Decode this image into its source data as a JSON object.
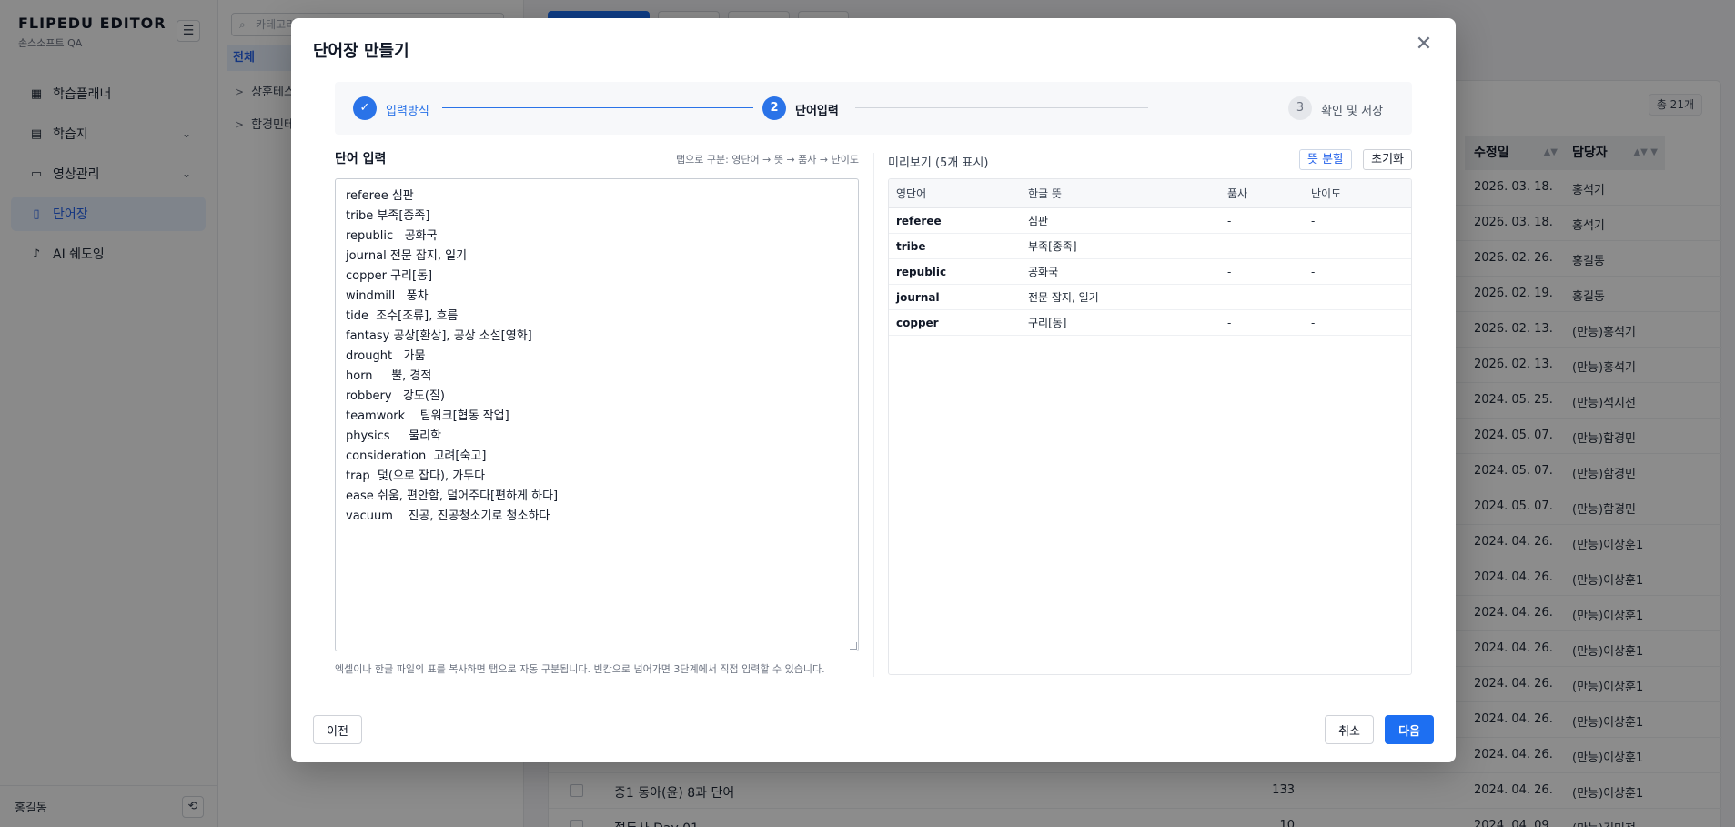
{
  "sidebar": {
    "brand_title": "FLIPEDU EDITOR",
    "brand_sub": "손스소프트 QA",
    "items": [
      {
        "label": "학습플래너",
        "icon": "calendar-icon",
        "has_chevron": false,
        "active": false
      },
      {
        "label": "학습지",
        "icon": "document-icon",
        "has_chevron": true,
        "active": false
      },
      {
        "label": "영상관리",
        "icon": "video-icon",
        "has_chevron": true,
        "active": false
      },
      {
        "label": "단어장",
        "icon": "book-icon",
        "has_chevron": false,
        "active": true
      },
      {
        "label": "AI 쉐도잉",
        "icon": "microphone-icon",
        "has_chevron": false,
        "active": false
      }
    ],
    "user": "홍길동"
  },
  "categories": {
    "search_placeholder": "카테고리",
    "all": "전체",
    "rows": [
      "상훈테스",
      "함경민테"
    ]
  },
  "list": {
    "total": "총 21개",
    "headers": {
      "modified": "수정일",
      "owner": "담당자"
    },
    "rows": [
      {
        "name": "",
        "count": "",
        "date": "2026. 03. 18.",
        "owner": "홍석기"
      },
      {
        "name": "",
        "count": "",
        "date": "2026. 03. 18.",
        "owner": "홍석기"
      },
      {
        "name": "",
        "count": "",
        "date": "2026. 02. 26.",
        "owner": "홍길동"
      },
      {
        "name": "",
        "count": "",
        "date": "2026. 02. 19.",
        "owner": "홍길동"
      },
      {
        "name": "",
        "count": "",
        "date": "2026. 02. 13.",
        "owner": "(만능)홍석기"
      },
      {
        "name": "",
        "count": "",
        "date": "2026. 02. 13.",
        "owner": "(만능)홍석기"
      },
      {
        "name": "",
        "count": "",
        "date": "2024. 05. 25.",
        "owner": "(만능)석지선"
      },
      {
        "name": "",
        "count": "",
        "date": "2024. 05. 07.",
        "owner": "(만능)함경민"
      },
      {
        "name": "",
        "count": "",
        "date": "2024. 05. 07.",
        "owner": "(만능)함경민"
      },
      {
        "name": "",
        "count": "",
        "date": "2024. 05. 07.",
        "owner": "(만능)함경민"
      },
      {
        "name": "",
        "count": "",
        "date": "2024. 04. 26.",
        "owner": "(만능)이상훈1"
      },
      {
        "name": "",
        "count": "",
        "date": "2024. 04. 26.",
        "owner": "(만능)이상훈1"
      },
      {
        "name": "",
        "count": "",
        "date": "2024. 04. 26.",
        "owner": "(만능)이상훈1"
      },
      {
        "name": "",
        "count": "",
        "date": "2024. 04. 26.",
        "owner": "(만능)이상훈1"
      },
      {
        "name": "",
        "count": "",
        "date": "2024. 04. 26.",
        "owner": "(만능)이상훈1"
      },
      {
        "name": "",
        "count": "",
        "date": "2024. 04. 26.",
        "owner": "(만능)이상훈1"
      },
      {
        "name": "",
        "count": "",
        "date": "2024. 04. 26.",
        "owner": "(만능)이상훈1"
      },
      {
        "name": "중1 동아(윤) 8과 단어",
        "count": "133",
        "date": "2024. 04. 26.",
        "owner": "(만능)이상훈1"
      },
      {
        "name": "접두사 Day 01",
        "count": "10",
        "date": "2024. 04. 09.",
        "owner": "(만능)김민정"
      }
    ]
  },
  "modal": {
    "title": "단어장 만들기",
    "steps": [
      {
        "number": "",
        "label": "입력방식",
        "state": "done"
      },
      {
        "number": "2",
        "label": "단어입력",
        "state": "current"
      },
      {
        "number": "3",
        "label": "확인 및 저장",
        "state": "pending"
      }
    ],
    "input": {
      "title": "단어 입력",
      "hint": "탭으로 구분: 영단어 → 뜻 → 품사 → 난이도",
      "text": "referee 심판\ntribe 부족[종족]\nrepublic   공화국\njournal 전문 잡지, 일기\ncopper 구리[동]\nwindmill   풍차\ntide  조수[조류], 흐름\nfantasy 공상[환상], 공상 소설[영화]\ndrought   가뭄\nhorn     뿔, 경적\nrobbery   강도(질)\nteamwork    팀워크[협동 작업]\nphysics     물리학\nconsideration  고려[숙고]\ntrap  덫(으로 잡다), 가두다\nease 쉬움, 편안함, 덜어주다[편하게 하다]\nvacuum    진공, 진공청소기로 청소하다",
      "footnote": "엑셀이나 한글 파일의 표를 복사하면 탭으로 자동 구분됩니다. 빈칸으로 넘어가면 3단계에서 직접 입력할 수 있습니다."
    },
    "preview": {
      "title": "미리보기 (5개 표시)",
      "split_label": "뜻 분할",
      "reset_label": "초기화",
      "headers": [
        "영단어",
        "한글 뜻",
        "품사",
        "난이도"
      ],
      "rows": [
        [
          "referee",
          "심판",
          "-",
          "-"
        ],
        [
          "tribe",
          "부족[종족]",
          "-",
          "-"
        ],
        [
          "republic",
          "공화국",
          "-",
          "-"
        ],
        [
          "journal",
          "전문 잡지, 일기",
          "-",
          "-"
        ],
        [
          "copper",
          "구리[동]",
          "-",
          "-"
        ]
      ]
    },
    "buttons": {
      "prev": "이전",
      "cancel": "취소",
      "next": "다음"
    }
  },
  "colors": {
    "accent": "#1d6ff2",
    "active_bg": "#e8f0fd"
  }
}
